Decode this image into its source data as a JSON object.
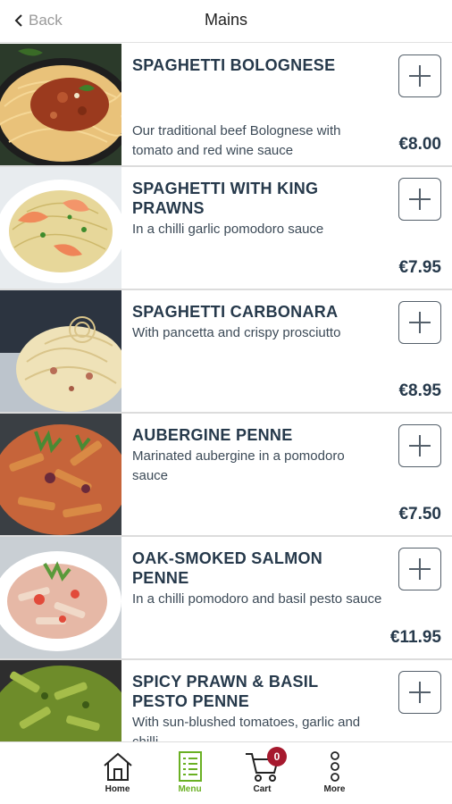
{
  "header": {
    "back_label": "Back",
    "title": "Mains"
  },
  "items": [
    {
      "name": "SPAGHETTI BOLOGNESE",
      "description": "Our traditional beef Bolognese with tomato and red wine sauce",
      "price": "€8.00",
      "image": "spaghetti-bolognese-image"
    },
    {
      "name": "SPAGHETTI WITH KING PRAWNS",
      "description": "In a chilli garlic pomodoro sauce",
      "price": "€7.95",
      "image": "spaghetti-king-prawns-image"
    },
    {
      "name": "SPAGHETTI CARBONARA",
      "description": "With pancetta and crispy prosciutto",
      "price": "€8.95",
      "image": "spaghetti-carbonara-image"
    },
    {
      "name": "AUBERGINE PENNE",
      "description": "Marinated aubergine in a pomodoro sauce",
      "price": "€7.50",
      "image": "aubergine-penne-image"
    },
    {
      "name": "OAK-SMOKED SALMON PENNE",
      "description": "In a chilli pomodoro and basil pesto sauce",
      "price": "€11.95",
      "image": "salmon-penne-image"
    },
    {
      "name": "SPICY PRAWN & BASIL PESTO PENNE",
      "description": "With sun-blushed tomatoes, garlic and chilli",
      "price": "",
      "image": "prawn-pesto-penne-image"
    }
  ],
  "tabbar": {
    "home": {
      "label": "Home",
      "icon": "home-icon"
    },
    "menu": {
      "label": "Menu",
      "icon": "menu-icon"
    },
    "cart": {
      "label": "Cart",
      "icon": "cart-icon",
      "count": "0"
    },
    "more": {
      "label": "More",
      "icon": "more-icon"
    }
  },
  "colors": {
    "accent": "#6ab023",
    "badge": "#a6192e",
    "text": "#26394b"
  }
}
